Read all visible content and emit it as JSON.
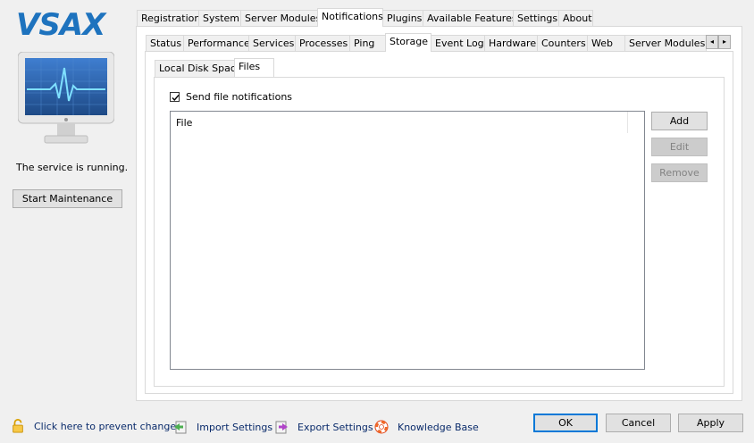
{
  "brand": {
    "logo_text": "VSAX",
    "accent": "#1e73be"
  },
  "sidebar": {
    "status_text": "The service is running.",
    "maintenance_button": "Start Maintenance"
  },
  "main_tabs": [
    "Registration",
    "System",
    "Server Modules",
    "Notifications",
    "Plugins",
    "Available Features",
    "Settings",
    "About"
  ],
  "main_active": "Notifications",
  "sub_tabs": [
    "Status",
    "Performance",
    "Services",
    "Processes",
    "Ping",
    "Storage",
    "Event Log",
    "Hardware",
    "Counters",
    "Web",
    "Server Modules"
  ],
  "sub_active": "Storage",
  "storage_tabs": [
    "Local Disk Space",
    "Files"
  ],
  "storage_active": "Files",
  "files": {
    "send_notifications_label": "Send file notifications",
    "send_notifications_checked": true,
    "list_header": "File",
    "add_label": "Add",
    "edit_label": "Edit",
    "remove_label": "Remove"
  },
  "footer": {
    "lock_label": "Click here to prevent changes",
    "import_label": "Import Settings",
    "export_label": "Export Settings",
    "kb_label": "Knowledge Base",
    "ok_label": "OK",
    "cancel_label": "Cancel",
    "apply_label": "Apply"
  },
  "icons": {
    "left_arrow": "◂",
    "right_arrow": "▸"
  }
}
